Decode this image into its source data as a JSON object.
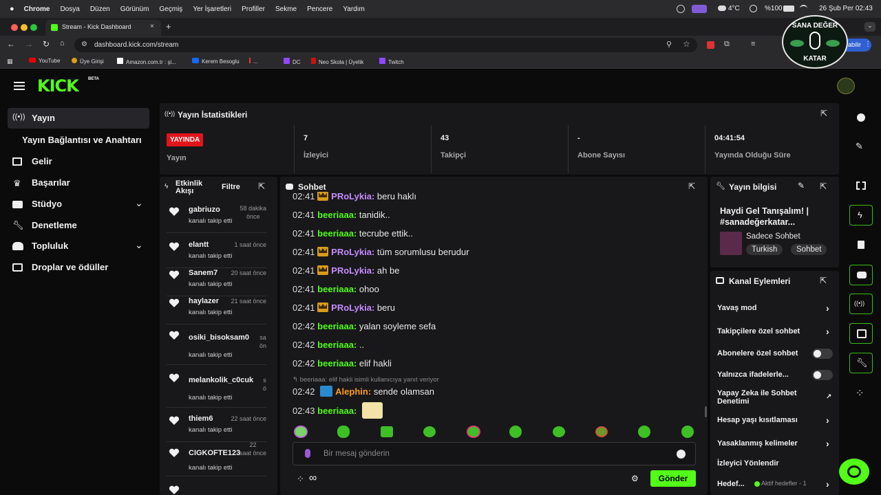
{
  "macos_menu": {
    "apple": "",
    "app": "Chrome",
    "items": [
      "Dosya",
      "Düzen",
      "Görünüm",
      "Geçmiş",
      "Yer İşaretleri",
      "Profiller",
      "Sekme",
      "Pencere",
      "Yardım"
    ],
    "temp": "4°C",
    "battery": "%100",
    "datetime": "26 Şub Per  02:43"
  },
  "browser": {
    "tab_title": "Stream - Kick Dashboard",
    "new_tab": "+",
    "url": "dashboard.kick.com/stream",
    "profile_btn": "abilir",
    "bookmarks": [
      "YouTube",
      "Üye Girişi",
      "Amazon.com.tr : şi...",
      "Kerem Besoglu",
      "...",
      "DC",
      "Neo Skola | Üyelik",
      "Twitch"
    ]
  },
  "overlay_logo": {
    "top": "SANA DEĞER",
    "bottom": "KATAR"
  },
  "colors": {
    "accent": "#53fc18",
    "live": "#e0151b",
    "panel": "#18181a",
    "bg": "#0b0b0c"
  },
  "kick": {
    "logo": "KICK",
    "beta": "BETA"
  },
  "sidebar": {
    "items": [
      {
        "label": "Yayın",
        "icon": "broadcast-icon"
      },
      {
        "label": "Yayın Bağlantısı ve Anahtarı",
        "icon": ""
      },
      {
        "label": "Gelir",
        "icon": "chart-icon"
      },
      {
        "label": "Başarılar",
        "icon": "trophy-icon"
      },
      {
        "label": "Stüdyo",
        "icon": "studio-icon"
      },
      {
        "label": "Denetleme",
        "icon": "wrench-icon"
      },
      {
        "label": "Topluluk",
        "icon": "users-icon"
      },
      {
        "label": "Droplar ve ödüller",
        "icon": "gift-icon"
      }
    ]
  },
  "stats": {
    "title": "Yayın İstatistikleri",
    "live_badge": "YAYINDA",
    "cols": [
      {
        "value": "",
        "label": "Yayın"
      },
      {
        "value": "7",
        "label": "İzleyici"
      },
      {
        "value": "43",
        "label": "Takipçi"
      },
      {
        "value": "-",
        "label": "Abone Sayısı"
      },
      {
        "value": "04:41:54",
        "label": "Yayında Olduğu Süre"
      }
    ]
  },
  "activity": {
    "title_line1": "Etkinlik",
    "title_line2": "Akışı",
    "filter": "Filtre",
    "events": [
      {
        "name": "gabriuzo",
        "time1": "58 dakika",
        "time2": "önce",
        "sub": "kanalı takip etti"
      },
      {
        "name": "elantt",
        "time1": "1 saat önce",
        "time2": "",
        "sub": "kanalı takip etti"
      },
      {
        "name": "Sanem7",
        "time1": "20 saat önce",
        "time2": "",
        "sub": "kanalı takip etti"
      },
      {
        "name": "haylazer",
        "time1": "21 saat önce",
        "time2": "",
        "sub": "kanalı takip etti"
      },
      {
        "name": "osiki_bisoksam0",
        "time1": "sa",
        "time2": "ön",
        "sub": "kanalı takip etti"
      },
      {
        "name": "melankolik_c0cuk",
        "time1": "s",
        "time2": "ö",
        "sub": "kanalı takip etti"
      },
      {
        "name": "thiem6",
        "time1": "22 saat önce",
        "time2": "",
        "sub": "kanalı takip etti"
      },
      {
        "name": "CIGKOFTE123",
        "time1": "22",
        "time2": "saat önce",
        "sub": "kanalı takip etti"
      }
    ]
  },
  "chat": {
    "title": "Sohbet",
    "messages": [
      {
        "time": "02:41",
        "user": "PRoLykia",
        "badge": "crown",
        "color": "purple",
        "text": "beru haklı"
      },
      {
        "time": "02:41",
        "user": "beeriaaa",
        "badge": "",
        "color": "green",
        "text": "tanidik.."
      },
      {
        "time": "02:41",
        "user": "beeriaaa",
        "badge": "",
        "color": "green",
        "text": "tecrube ettik.."
      },
      {
        "time": "02:41",
        "user": "PRoLykia",
        "badge": "crown",
        "color": "purple",
        "text": "tüm sorumlusu berudur"
      },
      {
        "time": "02:41",
        "user": "PRoLykia",
        "badge": "crown",
        "color": "purple",
        "text": "ah be"
      },
      {
        "time": "02:41",
        "user": "beeriaaa",
        "badge": "",
        "color": "green",
        "text": "ohoo"
      },
      {
        "time": "02:41",
        "user": "PRoLykia",
        "badge": "crown",
        "color": "purple",
        "text": "beru"
      },
      {
        "time": "02:42",
        "user": "beeriaaa",
        "badge": "",
        "color": "green",
        "text": "yalan soyleme sefa"
      },
      {
        "time": "02:42",
        "user": "beeriaaa",
        "badge": "",
        "color": "green",
        "text": ".."
      },
      {
        "time": "02:42",
        "user": "beeriaaa",
        "badge": "",
        "color": "green",
        "text": "elif hakli"
      }
    ],
    "reply_note": "beeriaaa: elif hakli isimli kullanıcıya yanıt veriyor",
    "reply_msg": {
      "time": "02:42",
      "user": "Alephin",
      "text": "sende olamsan"
    },
    "last_msg": {
      "time": "02:43",
      "user": "beeriaaa"
    },
    "placeholder": "Bir mesaj gönderin",
    "send": "Gönder"
  },
  "stream_info": {
    "title": "Yayın bilgisi",
    "stream_title": "Haydi Gel Tanışalım! | #sanadeğerkatar...",
    "category": "Sadece Sohbet",
    "tags": [
      "Turkish",
      "Sohbet"
    ]
  },
  "channel_actions": {
    "title": "Kanal Eylemleri",
    "items": [
      {
        "label": "Yavaş mod",
        "control": "chevron"
      },
      {
        "label": "Takipçilere özel sohbet",
        "control": "chevron"
      },
      {
        "label": "Abonelere özel sohbet",
        "control": "toggle"
      },
      {
        "label": "Yalnızca ifadelerle...",
        "control": "toggle"
      },
      {
        "label": "Yapay Zeka ile Sohbet Denetimi",
        "control": "external"
      },
      {
        "label": "Hesap yaşı kısıtlaması",
        "control": "chevron"
      },
      {
        "label": "Yasaklanmış kelimeler",
        "control": "chevron"
      },
      {
        "label": "İzleyici Yönlendir",
        "control": "none"
      },
      {
        "label": "Hedef...",
        "control": "chevron"
      }
    ],
    "goal_badge": "Aktif hedefler - 1"
  }
}
